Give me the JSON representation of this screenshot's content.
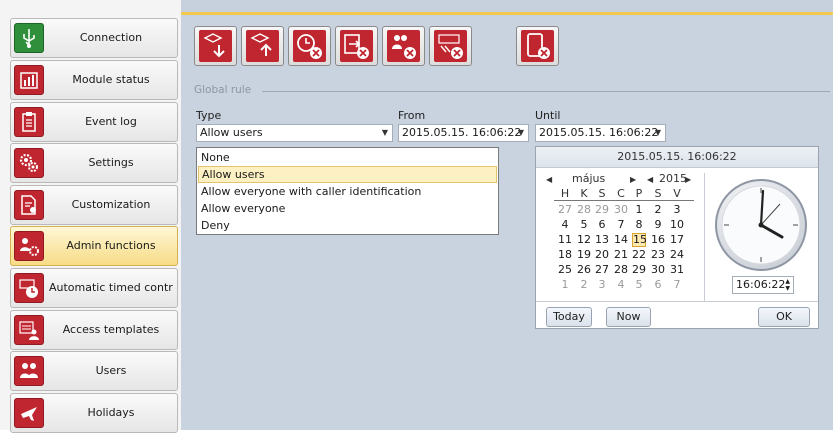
{
  "sidebar": {
    "items": [
      {
        "label": "Connection",
        "icon": "usb-icon",
        "active": false
      },
      {
        "label": "Module status",
        "icon": "bar-chart-icon",
        "active": false
      },
      {
        "label": "Event log",
        "icon": "clipboard-icon",
        "active": false
      },
      {
        "label": "Settings",
        "icon": "gears-icon",
        "active": false
      },
      {
        "label": "Customization",
        "icon": "document-settings-icon",
        "active": false
      },
      {
        "label": "Admin functions",
        "icon": "users-settings-icon",
        "active": true
      },
      {
        "label": "Automatic timed control",
        "icon": "device-clock-icon",
        "active": false
      },
      {
        "label": "Access templates",
        "icon": "calendar-users-icon",
        "active": false
      },
      {
        "label": "Users",
        "icon": "users-icon",
        "active": false
      },
      {
        "label": "Holidays",
        "icon": "airplane-icon",
        "active": false
      }
    ]
  },
  "toolbar": {
    "buttons": [
      {
        "name": "download-to-device-icon"
      },
      {
        "name": "upload-from-device-icon"
      },
      {
        "name": "clear-timer-icon"
      },
      {
        "name": "clear-export-icon"
      },
      {
        "name": "clear-users-icon"
      },
      {
        "name": "clear-device-icon"
      },
      {
        "name": "clear-phone-icon"
      }
    ]
  },
  "global_rule": {
    "legend": "Global rule",
    "type_label": "Type",
    "from_label": "From",
    "until_label": "Until",
    "type_value": "Allow users",
    "from_value": "2015.05.15. 16:06:22",
    "until_value": "2015.05.15. 16:06:22"
  },
  "type_options": [
    "None",
    "Allow users",
    "Allow everyone with caller identification",
    "Allow everyone",
    "Deny"
  ],
  "type_selected_index": 1,
  "picker": {
    "header": "2015.05.15. 16:06:22",
    "month": "május",
    "year": "2015",
    "weekdays": [
      "H",
      "K",
      "S",
      "C",
      "P",
      "S",
      "V"
    ],
    "weeks": [
      [
        "27",
        "28",
        "29",
        "30",
        "1",
        "2",
        "3"
      ],
      [
        "4",
        "5",
        "6",
        "7",
        "8",
        "9",
        "10"
      ],
      [
        "11",
        "12",
        "13",
        "14",
        "15",
        "16",
        "17"
      ],
      [
        "18",
        "19",
        "20",
        "21",
        "22",
        "23",
        "24"
      ],
      [
        "25",
        "26",
        "27",
        "28",
        "29",
        "30",
        "31"
      ],
      [
        "1",
        "2",
        "3",
        "4",
        "5",
        "6",
        "7"
      ]
    ],
    "selected_day": "15",
    "time": "16:06:22",
    "today_label": "Today",
    "now_label": "Now",
    "ok_label": "OK"
  },
  "colors": {
    "accent": "#c0262f",
    "highlight": "#fdf0c2",
    "topline": "#f2c94c"
  }
}
